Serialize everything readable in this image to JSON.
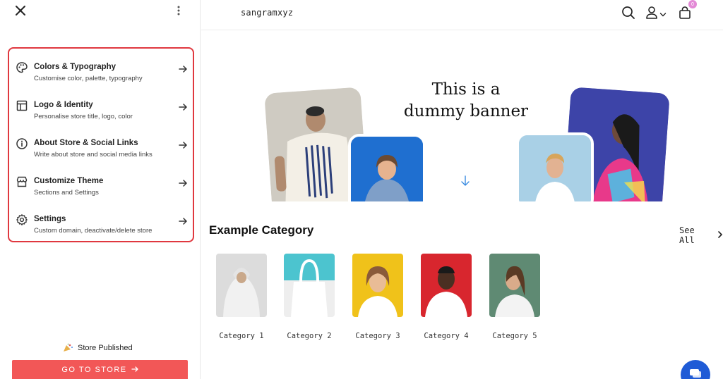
{
  "sidebar": {
    "menu": [
      {
        "title": "Colors & Typography",
        "subtitle": "Customise color, palette, typography",
        "icon": "palette-icon"
      },
      {
        "title": "Logo & Identity",
        "subtitle": "Personalise store title, logo, color",
        "icon": "layout-icon"
      },
      {
        "title": "About Store & Social Links",
        "subtitle": "Write about store and social media links",
        "icon": "info-icon"
      },
      {
        "title": "Customize Theme",
        "subtitle": "Sections and Settings",
        "icon": "storefront-icon"
      },
      {
        "title": "Settings",
        "subtitle": "Custom domain, deactivate/delete store",
        "icon": "gear-icon"
      }
    ],
    "status": "Store Published",
    "go_to_store": "GO TO STORE"
  },
  "store": {
    "brand": "sangramxyz",
    "cart_count": "0",
    "banner_line1": "This is a",
    "banner_line2": "dummy banner",
    "category_title": "Example Category",
    "see_all": "See All",
    "categories": [
      {
        "label": "Category 1"
      },
      {
        "label": "Category 2"
      },
      {
        "label": "Category 3"
      },
      {
        "label": "Category 4"
      },
      {
        "label": "Category 5"
      }
    ]
  },
  "colors": {
    "accent_red": "#e0383f",
    "button_red": "#f25757",
    "chat_blue": "#1f5bd6",
    "badge_pink": "#e38ad6"
  }
}
